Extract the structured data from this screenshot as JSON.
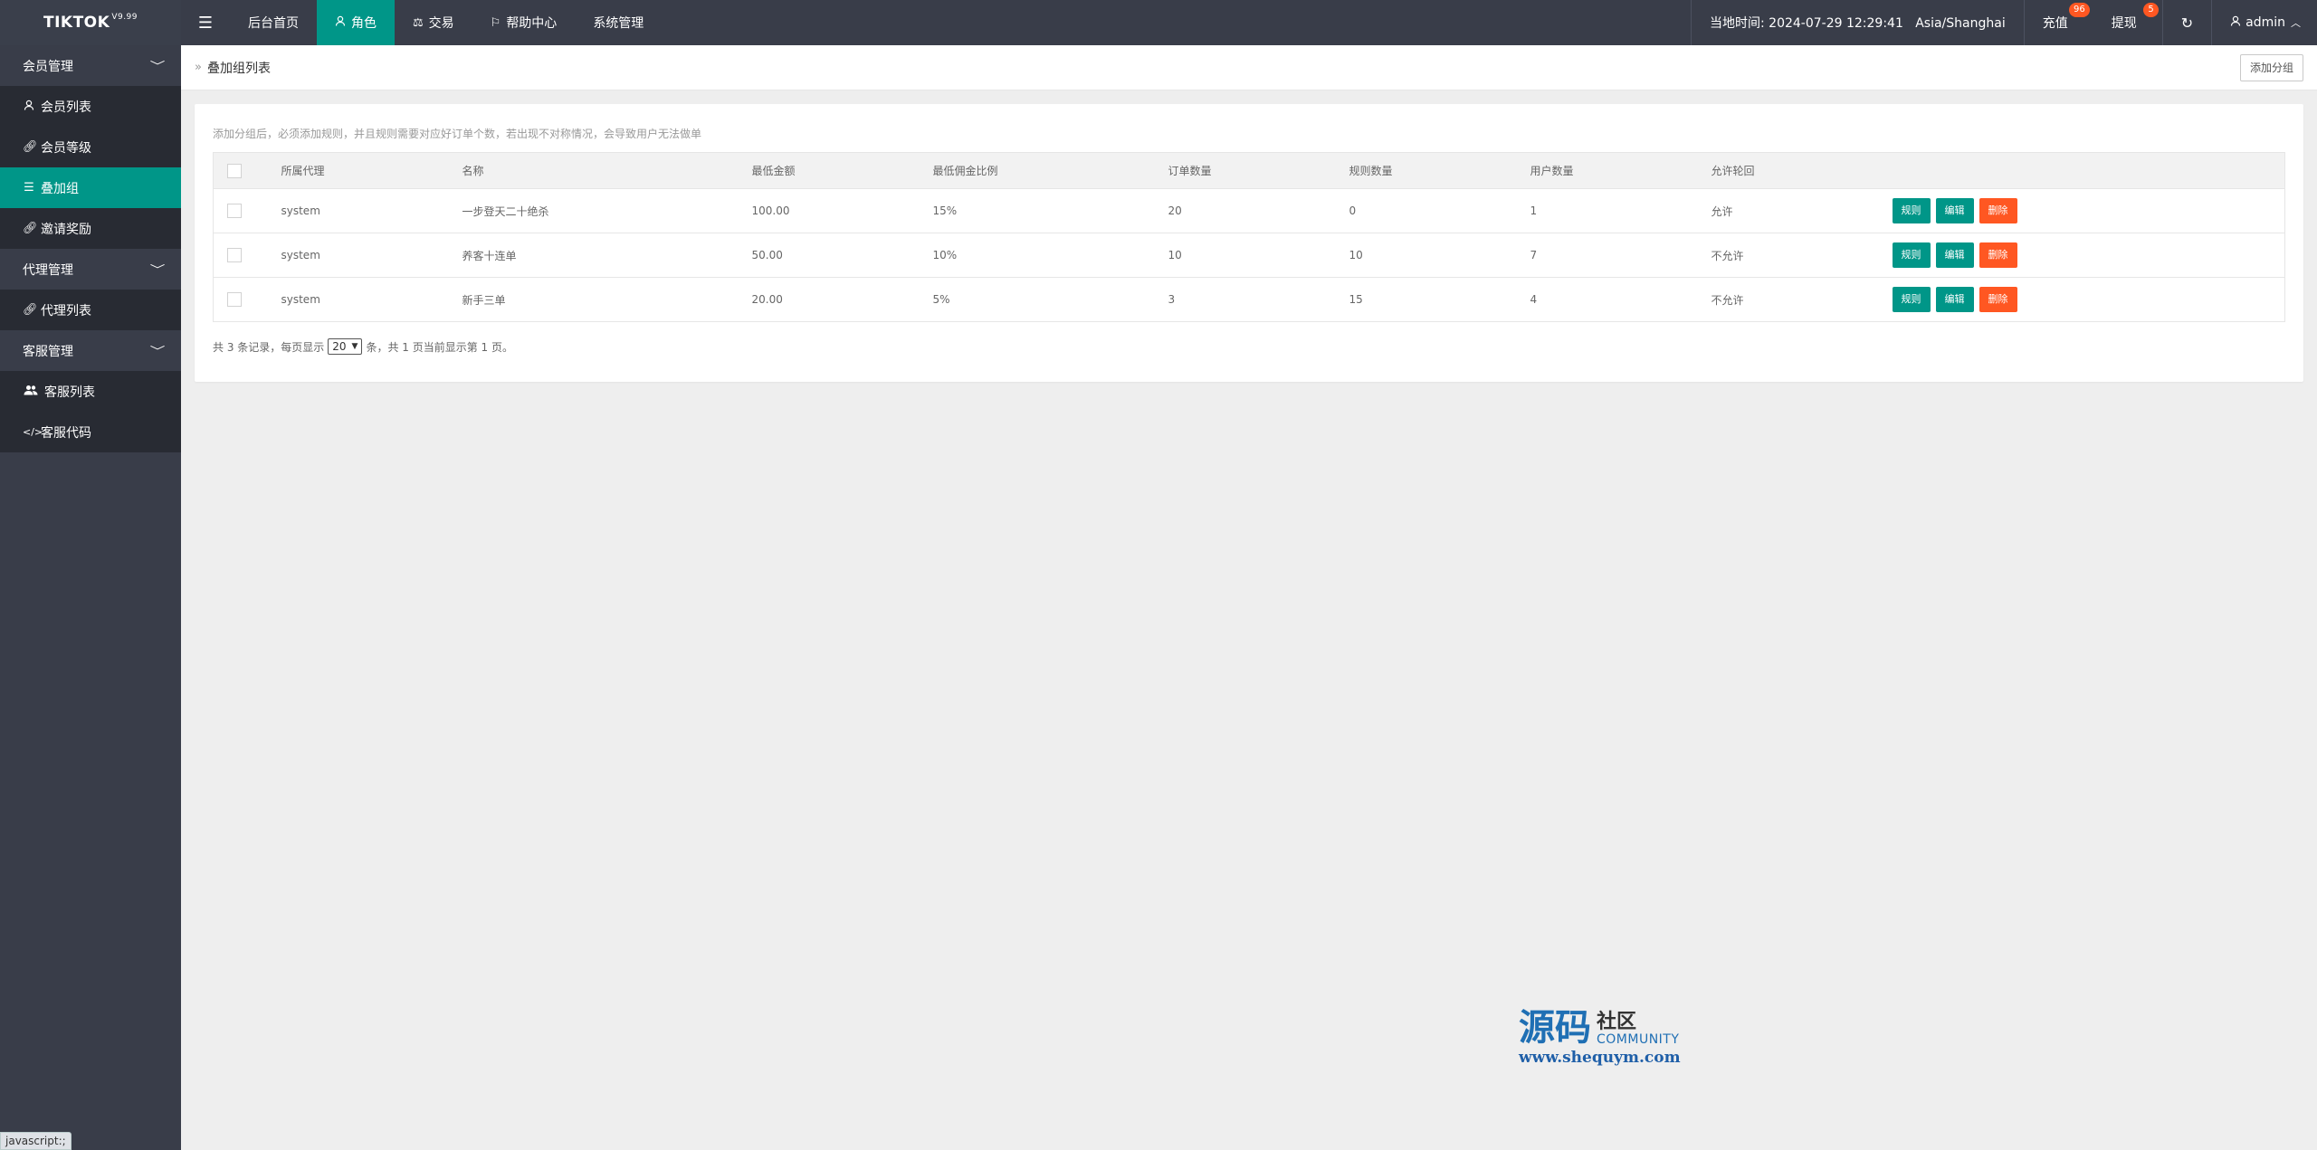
{
  "header": {
    "logo": "TIKTOK",
    "logo_version": "V9.99",
    "nav": [
      {
        "label": "后台首页",
        "icon": ""
      },
      {
        "label": "角色",
        "icon": "user-icon"
      },
      {
        "label": "交易",
        "icon": "scale-icon"
      },
      {
        "label": "帮助中心",
        "icon": "flag-icon"
      },
      {
        "label": "系统管理",
        "icon": ""
      }
    ],
    "time_text": "当地时间: 2024-07-29 12:29:41   Asia/Shanghai",
    "recharge_label": "充值",
    "recharge_badge": "96",
    "withdraw_label": "提现",
    "withdraw_badge": "5",
    "user_label": "admin"
  },
  "sidebar": {
    "groups": [
      {
        "label": "会员管理",
        "items": [
          {
            "label": "会员列表",
            "icon": "user-icon"
          },
          {
            "label": "会员等级",
            "icon": "link-icon"
          },
          {
            "label": "叠加组",
            "icon": "list-icon",
            "active": true
          },
          {
            "label": "邀请奖励",
            "icon": "link-icon"
          }
        ]
      },
      {
        "label": "代理管理",
        "items": [
          {
            "label": "代理列表",
            "icon": "link-icon"
          }
        ]
      },
      {
        "label": "客服管理",
        "items": [
          {
            "label": "客服列表",
            "icon": "users-icon"
          },
          {
            "label": "客服代码",
            "icon": "code-icon"
          }
        ]
      }
    ]
  },
  "page": {
    "breadcrumb": "叠加组列表",
    "add_button": "添加分组",
    "tip": "添加分组后，必须添加规则，并且规则需要对应好订单个数，若出现不对称情况，会导致用户无法做单"
  },
  "table": {
    "columns": [
      "所属代理",
      "名称",
      "最低金额",
      "最低佣金比例",
      "订单数量",
      "规则数量",
      "用户数量",
      "允许轮回"
    ],
    "rows": [
      [
        "system",
        "一步登天二十绝杀",
        "100.00",
        "15%",
        "20",
        "0",
        "1",
        "允许"
      ],
      [
        "system",
        "养客十连单",
        "50.00",
        "10%",
        "10",
        "10",
        "7",
        "不允许"
      ],
      [
        "system",
        "新手三单",
        "20.00",
        "5%",
        "3",
        "15",
        "4",
        "不允许"
      ]
    ],
    "actions": {
      "rules": "规则",
      "edit": "编辑",
      "delete": "删除"
    }
  },
  "pager": {
    "prefix": "共 3 条记录，每页显示",
    "page_size": "20",
    "suffix": "条，共 1 页当前显示第 1 页。"
  },
  "watermark": {
    "big": "源码",
    "small": "社区",
    "community": "COMMUNITY",
    "url": "www.shequym.com"
  },
  "status_tip": "javascript:;"
}
